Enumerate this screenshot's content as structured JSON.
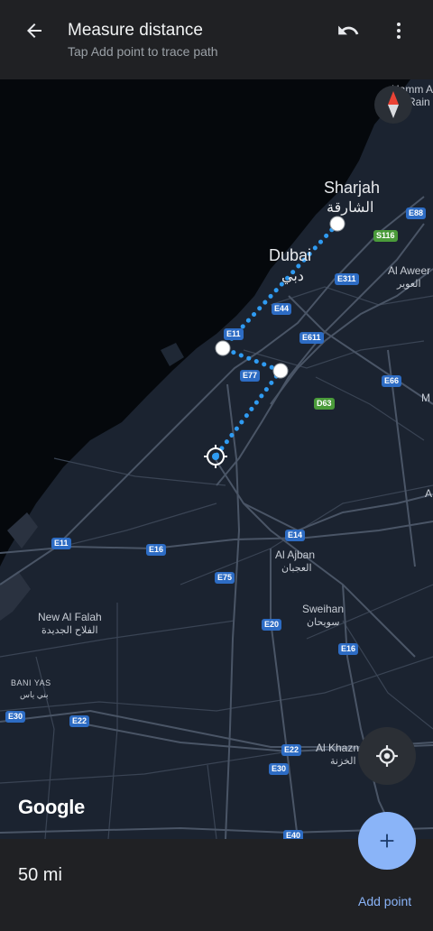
{
  "header": {
    "title": "Measure distance",
    "subtitle": "Tap Add point to trace path"
  },
  "map": {
    "cities": [
      {
        "name": "Sharjah",
        "name_ar": "الشارقة"
      },
      {
        "name": "Dubai",
        "name_ar": "دبي"
      }
    ],
    "places": [
      {
        "name": "Al Aweer",
        "name_ar": "العوير"
      },
      {
        "name": "Al Ajban",
        "name_ar": "العجبان"
      },
      {
        "name": "Sweihan",
        "name_ar": "سويحان"
      },
      {
        "name": "New Al Falah",
        "name_ar": "الفلاح الجديدة"
      },
      {
        "name": "Al Khazna",
        "name_ar": "الخزنة"
      },
      {
        "name": "BANI YAS",
        "name_ar": "بني ياس"
      }
    ],
    "edge_labels": [
      "Hamm Al",
      "Rain",
      "M",
      "A"
    ],
    "roads": [
      "E88",
      "S116",
      "E311",
      "E44",
      "E11",
      "E611",
      "E77",
      "D63",
      "E66",
      "E14",
      "E16",
      "E11",
      "E75",
      "E20",
      "E16",
      "E30",
      "E22",
      "E22",
      "E30",
      "E40"
    ],
    "attribution": "Google"
  },
  "colors": {
    "land": "#1b2330",
    "water": "#05080c",
    "road": "#4a5566",
    "highway_shield": "#2d6cc4",
    "path": "#2f9bf2",
    "accent": "#8ab4f8"
  },
  "footer": {
    "distance": "50 mi",
    "add_point_label": "Add point"
  }
}
